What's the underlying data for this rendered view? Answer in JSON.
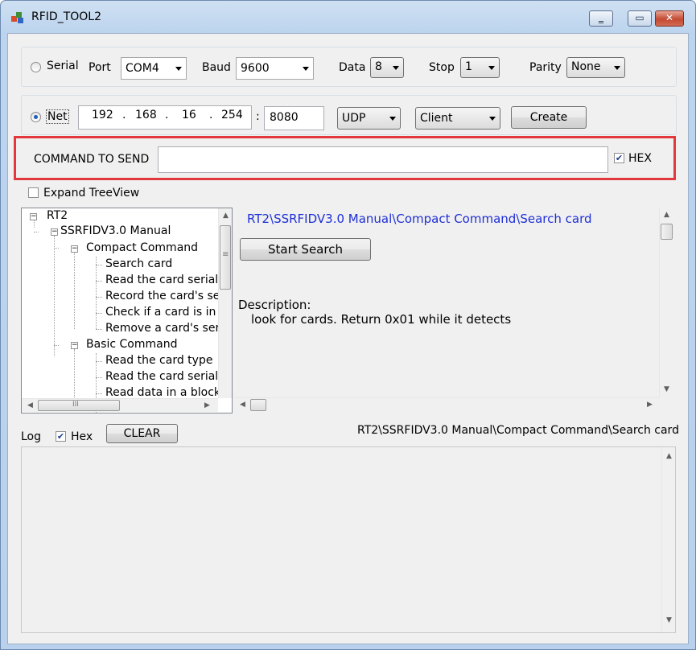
{
  "window": {
    "title": "RFID_TOOL2"
  },
  "serial": {
    "mode_label": "Serial",
    "port_label": "Port",
    "port_value": "COM4",
    "baud_label": "Baud",
    "baud_value": "9600",
    "data_label": "Data",
    "data_value": "8",
    "stop_label": "Stop",
    "stop_value": "1",
    "parity_label": "Parity",
    "parity_value": "None"
  },
  "net": {
    "mode_label": "Net",
    "ip": [
      "192",
      "168",
      "16",
      "254"
    ],
    "dot": ".",
    "colon": ":",
    "port_value": "8080",
    "protocol_value": "UDP",
    "role_value": "Client",
    "create_label": "Create"
  },
  "command": {
    "label": "COMMAND TO SEND",
    "value": "",
    "hex_label": "HEX",
    "hex_checked": true
  },
  "treeview": {
    "expand_label": "Expand TreeView",
    "items": [
      "RT2",
      "SSRFIDV3.0 Manual",
      "Compact Command",
      "Search card",
      "Read the card serial",
      "Record the card's se",
      "Check if a card is in",
      "Remove a card's ser",
      "Basic Command",
      "Read the card type",
      "Read the card serial",
      "Read data in a block"
    ],
    "scroll_grip": "≡",
    "hscroll_grip": "III"
  },
  "detail": {
    "path": "RT2\\SSRFIDV3.0 Manual\\Compact Command\\Search card",
    "action_label": "Start Search",
    "description_heading": "Description:",
    "description_body": "look for cards. Return 0x01 while it detects"
  },
  "log": {
    "label": "Log",
    "hex_label": "Hex",
    "hex_checked": true,
    "clear_label": "CLEAR",
    "status_path": "RT2\\SSRFIDV3.0 Manual\\Compact Command\\Search card"
  },
  "glyphs": {
    "up": "▲",
    "down": "▼",
    "left": "◀",
    "right": "▶",
    "minimize": "‗",
    "maximize": "▭",
    "close": "✕",
    "check": "✔",
    "minus": "−"
  },
  "colors": {
    "highlight": "#e3393c",
    "path_blue": "#1e2fd6",
    "titlebar": "#bcd4ee"
  }
}
